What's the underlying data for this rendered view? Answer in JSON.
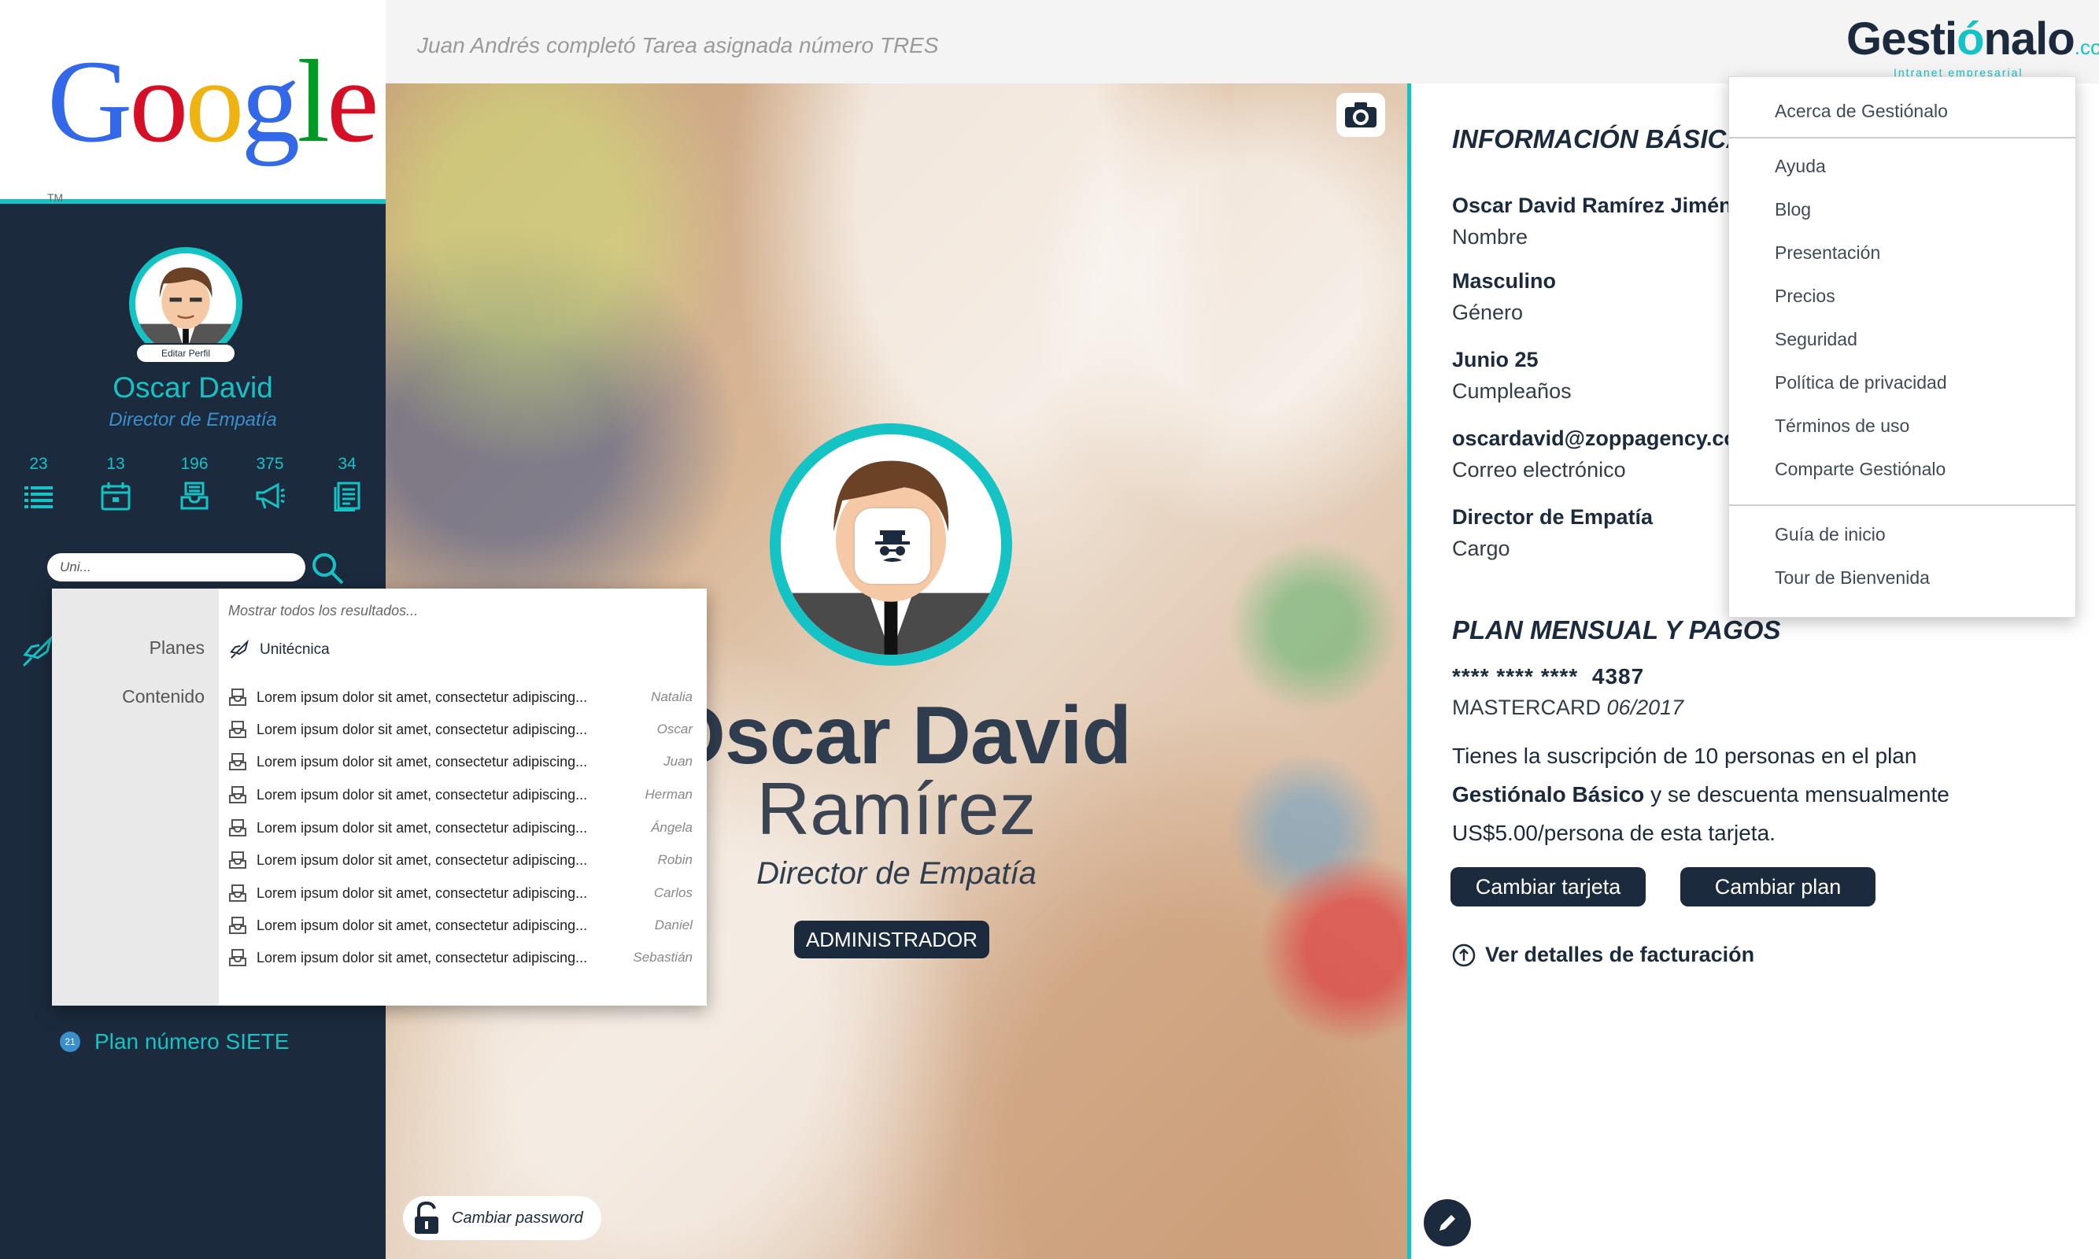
{
  "google_logo": {
    "letters": [
      "G",
      "o",
      "o",
      "g",
      "l",
      "e"
    ],
    "colors": [
      "#3369e8",
      "#d50f25",
      "#eeb211",
      "#3369e8",
      "#009925",
      "#d50f25"
    ],
    "tm": "TM"
  },
  "sidebar": {
    "edit_profile": "Editar Perfil",
    "name": "Oscar David",
    "role": "Director de Empatía",
    "stats": [
      {
        "value": "23",
        "icon": "list-icon"
      },
      {
        "value": "13",
        "icon": "calendar-icon"
      },
      {
        "value": "196",
        "icon": "inbox-icon"
      },
      {
        "value": "375",
        "icon": "megaphone-icon"
      },
      {
        "value": "34",
        "icon": "document-icon"
      }
    ],
    "search_value": "Uni...",
    "plan_badge": "21",
    "plan_item": "Plan número SIETE"
  },
  "topbar": {
    "notification": "Juan Andrés completó Tarea asignada número TRES",
    "brand_main": "Gesti",
    "brand_accent": "ó",
    "brand_rest": "nalo",
    "brand_tld": ".co",
    "brand_sub": "Intranet empresarial"
  },
  "cover": {
    "first_name": "Oscar David",
    "last_name": "Ramírez",
    "role": "Director de Empatía",
    "badge": "ADMINISTRADOR",
    "password_button": "Cambiar password"
  },
  "panel": {
    "info_title": "INFORMACIÓN BÁSICA",
    "fields": [
      {
        "value": "Oscar David Ramírez Jiménez",
        "label": "Nombre"
      },
      {
        "value": "Masculino",
        "label": "Género"
      },
      {
        "value": "Junio 25",
        "label": "Cumpleaños"
      },
      {
        "value": "oscardavid@zoppagency.com",
        "label": "Correo electrónico"
      },
      {
        "value": "Director de Empatía",
        "label": "Cargo"
      }
    ],
    "plan_title": "PLAN MENSUAL Y PAGOS",
    "card_mask": "****  ****  ****",
    "card_last": "4387",
    "card_brand": "MASTERCARD",
    "card_exp": "06/2017",
    "plan_text_1": "Tienes la suscripción de 10 personas en el plan",
    "plan_text_bold": "Gestiónalo Básico",
    "plan_text_2": " y se descuenta mensualmente",
    "plan_text_3": "US$5.00/persona de esta tarjeta.",
    "change_card": "Cambiar tarjeta",
    "change_plan": "Cambiar plan",
    "billing_link": "Ver detalles de facturación"
  },
  "menu": {
    "items": [
      "Acerca de Gestiónalo",
      "Ayuda",
      "Blog",
      "Presentación",
      "Precios",
      "Seguridad",
      "Política de privacidad",
      "Términos de uso",
      "Comparte Gestiónalo",
      "Guía de inicio",
      "Tour de Bienvenida"
    ]
  },
  "results": {
    "show_all": "Mostrar todos los resultados...",
    "cat_plans": "Planes",
    "cat_content": "Contenido",
    "plan_result": "Unitécnica",
    "rows": [
      {
        "text": "Lorem ipsum dolor sit amet, consectetur adipiscing...",
        "who": "Natalia"
      },
      {
        "text": "Lorem ipsum dolor sit amet, consectetur adipiscing...",
        "who": "Oscar"
      },
      {
        "text": "Lorem ipsum dolor sit amet, consectetur adipiscing...",
        "who": "Juan"
      },
      {
        "text": "Lorem ipsum dolor sit amet, consectetur adipiscing...",
        "who": "Herman"
      },
      {
        "text": "Lorem ipsum dolor sit amet, consectetur adipiscing...",
        "who": "Ángela"
      },
      {
        "text": "Lorem ipsum dolor sit amet, consectetur adipiscing...",
        "who": "Robin"
      },
      {
        "text": "Lorem ipsum dolor sit amet, consectetur adipiscing...",
        "who": "Carlos"
      },
      {
        "text": "Lorem ipsum dolor sit amet, consectetur adipiscing...",
        "who": "Daniel"
      },
      {
        "text": "Lorem ipsum dolor sit amet, consectetur adipiscing...",
        "who": "Sebastián"
      }
    ]
  },
  "colors": {
    "accent": "#16c3c4",
    "navy": "#1b2a3d",
    "blue": "#3a8fcc"
  }
}
